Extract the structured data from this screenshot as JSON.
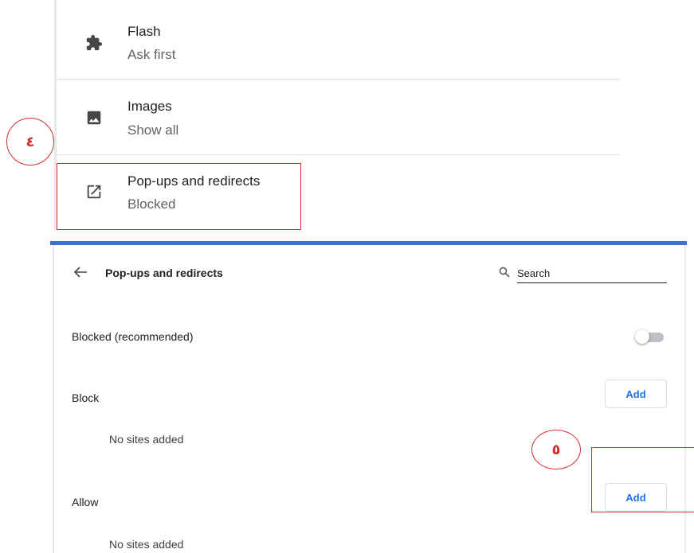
{
  "settings_list": {
    "items": [
      {
        "title": "Flash",
        "subtitle": "Ask first",
        "icon": "puzzle-piece-icon"
      },
      {
        "title": "Images",
        "subtitle": "Show all",
        "icon": "image-icon"
      },
      {
        "title": "Pop-ups and redirects",
        "subtitle": "Blocked",
        "icon": "open-in-new-icon"
      }
    ]
  },
  "annotations": {
    "step_4": "٤",
    "step_5": "٥",
    "color": "#d32f2f"
  },
  "popups_page": {
    "title": "Pop-ups and redirects",
    "search_placeholder": "Search",
    "blocked_label": "Blocked (recommended)",
    "blocked_toggle_on": false,
    "block_section": {
      "label": "Block",
      "add_label": "Add",
      "empty_text": "No sites added"
    },
    "allow_section": {
      "label": "Allow",
      "add_label": "Add",
      "empty_text": "No sites added"
    }
  },
  "colors": {
    "accent_blue": "#1a73e8",
    "header_bar": "#3d6fd8",
    "icon_gray": "#444746"
  }
}
